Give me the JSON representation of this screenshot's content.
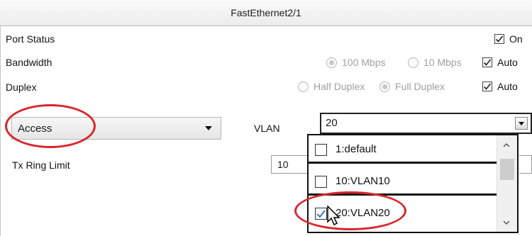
{
  "window": {
    "title": "FastEthernet2/1"
  },
  "port_status": {
    "label": "Port Status",
    "on_label": "On",
    "on_checked": true
  },
  "bandwidth": {
    "label": "Bandwidth",
    "options": [
      "100 Mbps",
      "10 Mbps"
    ],
    "selected": "100 Mbps",
    "auto_label": "Auto",
    "auto_checked": true
  },
  "duplex": {
    "label": "Duplex",
    "options": [
      "Half Duplex",
      "Full Duplex"
    ],
    "selected": "Full Duplex",
    "auto_label": "Auto",
    "auto_checked": true
  },
  "mode": {
    "value": "Access"
  },
  "vlan": {
    "label": "VLAN",
    "value": "20",
    "options": [
      {
        "label": "1:default",
        "checked": false
      },
      {
        "label": "10:VLAN10",
        "checked": false
      },
      {
        "label": "20:VLAN20",
        "checked": true
      }
    ]
  },
  "tx_ring": {
    "label": "Tx Ring Limit",
    "value": "10"
  },
  "colors": {
    "highlight": "#d9262c",
    "check": "#3a7bd5"
  }
}
